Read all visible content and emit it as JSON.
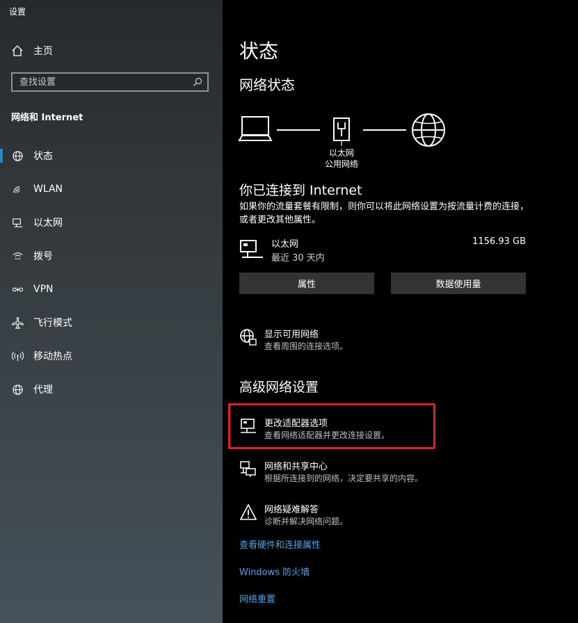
{
  "window": {
    "title": "设置"
  },
  "sidebar": {
    "home_label": "主页",
    "search_placeholder": "查找设置",
    "section_title": "网络和 Internet",
    "items": [
      {
        "label": "状态",
        "icon": "globe-icon",
        "active": true
      },
      {
        "label": "WLAN",
        "icon": "wifi-icon",
        "active": false
      },
      {
        "label": "以太网",
        "icon": "ethernet-icon",
        "active": false
      },
      {
        "label": "拨号",
        "icon": "dialup-icon",
        "active": false
      },
      {
        "label": "VPN",
        "icon": "vpn-icon",
        "active": false
      },
      {
        "label": "飞行模式",
        "icon": "airplane-icon",
        "active": false
      },
      {
        "label": "移动热点",
        "icon": "hotspot-icon",
        "active": false
      },
      {
        "label": "代理",
        "icon": "globe-icon",
        "active": false
      }
    ]
  },
  "main": {
    "title": "状态",
    "network_status_heading": "网络状态",
    "diagram_caption": [
      "以太网",
      "公用网络"
    ],
    "connected_title": "你已连接到 Internet",
    "connected_desc": "如果你的流量套餐有限制，则你可以将此网络设置为按流量计费的连接，或者更改其他属性。",
    "adapter": {
      "name": "以太网",
      "period": "最近 30 天内",
      "usage": "1156.93 GB"
    },
    "buttons": {
      "properties": "属性",
      "data_usage": "数据使用量"
    },
    "show_networks": {
      "title": "显示可用网络",
      "desc": "查看周围的连接选项。"
    },
    "advanced_heading": "高级网络设置",
    "advanced_items": [
      {
        "title": "更改适配器选项",
        "desc": "查看网络适配器并更改连接设置。"
      },
      {
        "title": "网络和共享中心",
        "desc": "根据所连接到的网络，决定要共享的内容。"
      },
      {
        "title": "网络疑难解答",
        "desc": "诊断并解决网络问题。"
      }
    ],
    "links": [
      "查看硬件和连接属性",
      "Windows 防火墙",
      "网络重置"
    ],
    "colors": {
      "accent": "#1e8ad6",
      "link": "#4ba3ea",
      "highlight": "#e0202a",
      "button_bg": "#333333"
    }
  }
}
